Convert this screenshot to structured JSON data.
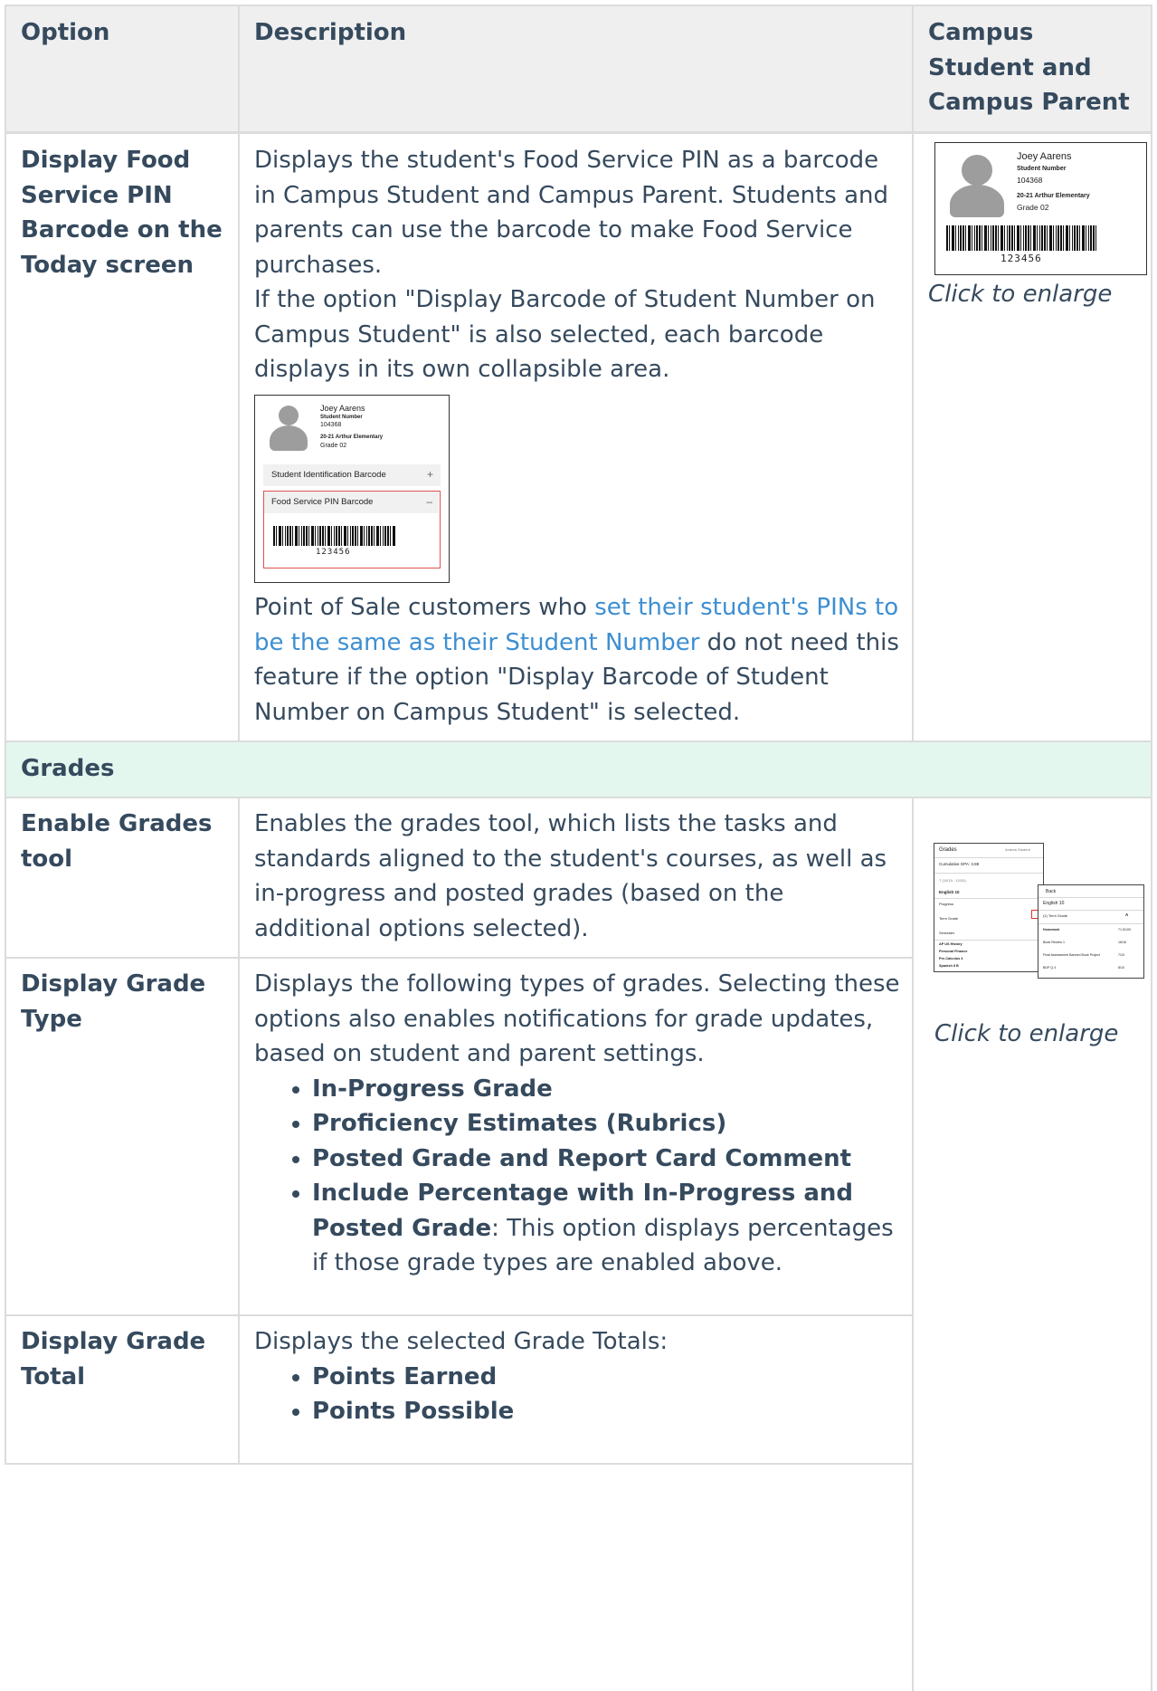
{
  "table": {
    "headers": {
      "option": "Option",
      "description": "Description",
      "campus": [
        "Campus",
        "Student and",
        "Campus Parent"
      ]
    },
    "food_service_row": {
      "option": [
        "Display Food",
        "Service PIN",
        "Barcode on the",
        "Today screen"
      ],
      "desc_p1": "Displays the student's Food Service PIN as a barcode in Campus Student and Campus Parent. Students and parents can use the barcode to make Food Service purchases.",
      "desc_p2": "If the option \"Display Barcode of Student Number on Campus Student\" is also selected, each barcode displays in its own collapsible area.",
      "desc_p3_before": "Point of Sale customers who ",
      "desc_p3_link": "set their student's PINs to be the same as their Student Number",
      "desc_p3_after": " do not need this feature if the option \"Display Barcode of Student Number on Campus Student\" is selected.",
      "caption": "Click to enlarge",
      "screenshot_small": {
        "name": "Joey Aarens",
        "student_number_label": "Student Number",
        "student_number": "104368",
        "school": "20-21 Arthur Elementary",
        "grade": "Grade 02",
        "barcode_number": "123456"
      },
      "screenshot_inline": {
        "name": "Joey Aarens",
        "student_number_label": "Student Number",
        "student_number": "104368",
        "school": "20-21 Arthur Elementary",
        "grade": "Grade 02",
        "panel_student_id": "Student Identification Barcode",
        "panel_student_id_icon": "+",
        "panel_food": "Food Service PIN Barcode",
        "panel_food_icon": "–",
        "barcode_number": "123456"
      }
    },
    "grades_section": {
      "title": "Grades"
    },
    "enable_grades_row": {
      "option": [
        "Enable Grades",
        "tool"
      ],
      "description": "Enables the grades tool, which lists the tasks and standards aligned to the student's courses, as well as in-progress and posted grades (based on the additional options selected)."
    },
    "grade_type_row": {
      "option": [
        "Display Grade",
        "Type"
      ],
      "description": "Displays the following types of grades. Selecting these options also enables notifications for grade updates, based on student and parent settings.",
      "items": [
        {
          "bold": "In-Progress Grade",
          "rest": ""
        },
        {
          "bold": "Proficiency Estimates (Rubrics)",
          "rest": ""
        },
        {
          "bold": "Posted Grade and Report Card Comment",
          "rest": ""
        },
        {
          "bold": "Include Percentage with In-Progress and Posted Grade",
          "rest": ": This option displays percentages if those grade types are enabled above."
        }
      ]
    },
    "grade_total_row": {
      "option": [
        "Display Grade",
        "Total"
      ],
      "description": "Displays the selected Grade Totals:",
      "items": [
        {
          "bold": "Points Earned"
        },
        {
          "bold": "Points Possible"
        }
      ]
    },
    "grades_caption": "Click to enlarge",
    "grades_screenshot": {
      "left_title": "Grades",
      "left_student": "Andrea Student",
      "cumulative": "Cumulative GPA: 3.88",
      "term": "T (10/15 - 12/20)",
      "course": "English 10",
      "rows": [
        "Progress",
        "Term Grade",
        "Semester"
      ],
      "courses_more": [
        "AP US History",
        "Personal Finance",
        "Pre-Calculus 4",
        "Spanish II B"
      ],
      "right_back": "Back",
      "right_course": "English 10",
      "right_grade_label": "(1) Term Grade",
      "right_grade_value": "A",
      "right_items": [
        "Homework",
        "Book Review 1",
        "Final Assessment Banned Book Project",
        "BDP Q 4"
      ],
      "right_scores": [
        "71.5/100",
        "16/16",
        "7/10",
        "8/10"
      ]
    }
  }
}
